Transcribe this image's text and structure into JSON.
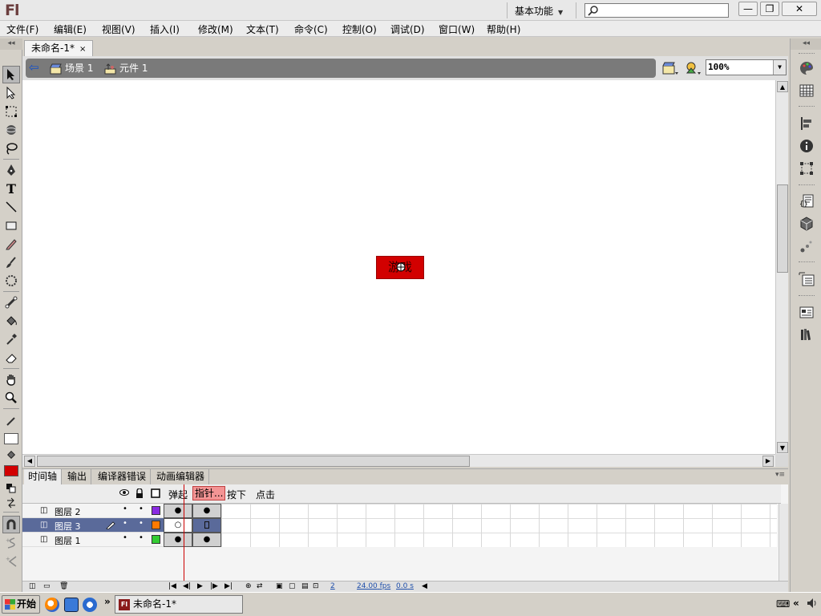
{
  "app": {
    "logo": "Fl",
    "workspace": "基本功能",
    "search_placeholder": ""
  },
  "window_controls": {
    "minimize": "—",
    "maximize": "❐",
    "close": "✕"
  },
  "menu": [
    "文件(F)",
    "编辑(E)",
    "视图(V)",
    "插入(I)",
    "修改(M)",
    "文本(T)",
    "命令(C)",
    "控制(O)",
    "调试(D)",
    "窗口(W)",
    "帮助(H)"
  ],
  "document": {
    "tab_title": "未命名-1*",
    "close_glyph": "×"
  },
  "editbar": {
    "back_glyph": "⇦",
    "scene_label": "场景 1",
    "symbol_label": "元件 1",
    "zoom": "100%"
  },
  "stage": {
    "button_label": "游戏",
    "button_color": "#d20000"
  },
  "panel_tabs": [
    "时间轴",
    "输出",
    "编译器错误",
    "动画编辑器"
  ],
  "timeline": {
    "frame_headers": {
      "up": "弹起",
      "over": "指针...",
      "down": "按下",
      "hit": "点击"
    },
    "layers": [
      {
        "name": "图层 2",
        "color": "#8a2be2",
        "selected": false
      },
      {
        "name": "图层 3",
        "color": "#ff7a00",
        "selected": true
      },
      {
        "name": "图层 1",
        "color": "#33cc33",
        "selected": false
      }
    ],
    "current_frame": "2",
    "fps": "24.00",
    "fps_unit": "fps",
    "elapsed": "0.0",
    "elapsed_unit": "s"
  },
  "taskbar": {
    "start_label": "开始",
    "task_label": "未命名-1*",
    "task_icon": "Fl",
    "expand_glyph": "«"
  }
}
